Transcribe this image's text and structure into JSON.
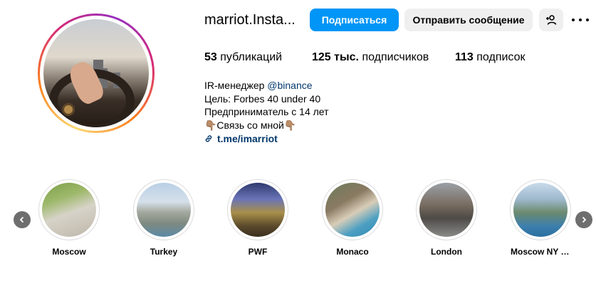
{
  "profile": {
    "username": "marriot.Insta...",
    "follow_label": "Подписаться",
    "message_label": "Отправить сообщение",
    "add_user_icon": "person-plus-icon",
    "more_icon": "more-options-icon"
  },
  "stats": {
    "posts_count": "53",
    "posts_label": "публикаций",
    "followers_count": "125 тыс.",
    "followers_label": "подписчиков",
    "following_count": "113",
    "following_label": "подписок"
  },
  "bio": {
    "line1_text": "IR-менеджер ",
    "line1_mention": "@binance",
    "line2": "Цель: Forbes 40 under 40",
    "line3": "Предприниматель с 14 лет",
    "line4": "👇🏽Связь со мной👇🏽",
    "link": "t.me/imarriot"
  },
  "highlights": [
    {
      "label": "Moscow"
    },
    {
      "label": "Turkey"
    },
    {
      "label": "PWF"
    },
    {
      "label": "Monaco"
    },
    {
      "label": "London"
    },
    {
      "label": "Moscow NY 2..."
    }
  ],
  "colors": {
    "accent": "#0095f6",
    "link": "#00376b",
    "button_secondary": "#efefef"
  }
}
